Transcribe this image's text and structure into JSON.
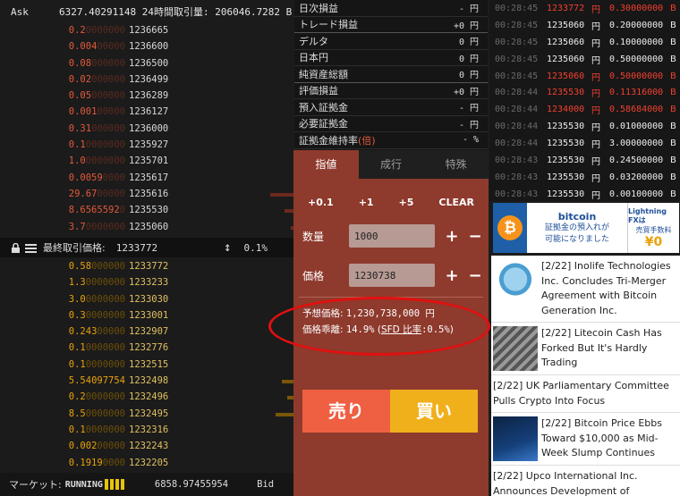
{
  "book": {
    "ask_label": "Ask",
    "header_text": "6327.40291148 24時間取引量: 206046.7282 B",
    "asks": [
      {
        "amt": "0.2",
        "dim": "0000000",
        "px": "1236665",
        "bar": 0
      },
      {
        "amt": "0.004",
        "dim": "00000",
        "px": "1236600",
        "bar": 0
      },
      {
        "amt": "0.08",
        "dim": "000000",
        "px": "1236500",
        "bar": 0
      },
      {
        "amt": "0.02",
        "dim": "000000",
        "px": "1236499",
        "bar": 0
      },
      {
        "amt": "0.05",
        "dim": "000000",
        "px": "1236289",
        "bar": 0
      },
      {
        "amt": "0.001",
        "dim": "00000",
        "px": "1236127",
        "bar": 0
      },
      {
        "amt": "0.31",
        "dim": "000000",
        "px": "1236000",
        "bar": 0
      },
      {
        "amt": "0.1",
        "dim": "0000000",
        "px": "1235927",
        "bar": 0
      },
      {
        "amt": "1.0",
        "dim": "0000000",
        "px": "1235701",
        "bar": 0
      },
      {
        "amt": "0.0059",
        "dim": "0000",
        "px": "1235617",
        "bar": 0
      },
      {
        "amt": "29.67",
        "dim": "00000",
        "px": "1235616",
        "bar": 0.08
      },
      {
        "amt": "8.6565592",
        "dim": "0",
        "px": "1235530",
        "bar": 0.03
      },
      {
        "amt": "3.7",
        "dim": "0000000",
        "px": "1235060",
        "bar": 0.01
      }
    ],
    "last_price_label": "最終取引価格:",
    "last_price": "1233772",
    "spread_pct": "0.1%",
    "bids": [
      {
        "px": "1233772",
        "amt": "0.58",
        "dim": "000000",
        "bar": 0
      },
      {
        "px": "1233233",
        "amt": "1.3",
        "dim": "0000000",
        "bar": 0
      },
      {
        "px": "1233030",
        "amt": "3.0",
        "dim": "0000000",
        "bar": 0
      },
      {
        "px": "1233001",
        "amt": "0.3",
        "dim": "0000000",
        "bar": 0
      },
      {
        "px": "1232907",
        "amt": "0.243",
        "dim": "00000",
        "bar": 0
      },
      {
        "px": "1232776",
        "amt": "0.1",
        "dim": "0000000",
        "bar": 0
      },
      {
        "px": "1232515",
        "amt": "0.1",
        "dim": "0000000",
        "bar": 0
      },
      {
        "px": "1232498",
        "amt": "5.54097754",
        "dim": "",
        "bar": 0.04
      },
      {
        "px": "1232496",
        "amt": "0.2",
        "dim": "0000000",
        "bar": 0.02
      },
      {
        "px": "1232495",
        "amt": "8.5",
        "dim": "0000000",
        "bar": 0.06
      },
      {
        "px": "1232316",
        "amt": "0.1",
        "dim": "0000000",
        "bar": 0
      },
      {
        "px": "1232243",
        "amt": "0.002",
        "dim": "00000",
        "bar": 0
      },
      {
        "px": "1232205",
        "amt": "0.1919",
        "dim": "0000",
        "bar": 0
      }
    ],
    "market_label": "マーケット:",
    "market_status": "RUNNING",
    "bid_volume": "6858.97455954",
    "bid_label": "Bid",
    "colors": {
      "ask": "#e25a3a",
      "bid": "#e8a20c"
    }
  },
  "account": {
    "rows": [
      {
        "label": "日次損益",
        "value": "- 円"
      },
      {
        "label": "トレード損益",
        "value": "+0 円"
      },
      {
        "label": "デルタ",
        "value": "0 円"
      },
      {
        "label": "日本円",
        "value": "0 円"
      },
      {
        "label": "純資産総額",
        "value": "0 円"
      },
      {
        "label": "評価損益",
        "value": "+0 円"
      },
      {
        "label": "預入証拠金",
        "value": "- 円"
      },
      {
        "label": "必要証拠金",
        "value": "- 円"
      },
      {
        "label": "証拠金維持率",
        "label_suffix": "(倍)",
        "value": "- %"
      }
    ]
  },
  "order": {
    "tabs": [
      "指値",
      "成行",
      "特殊"
    ],
    "quick_buttons": [
      "+0.1",
      "+1",
      "+5",
      "CLEAR"
    ],
    "qty_label": "数量",
    "qty_value": "1000",
    "price_label": "価格",
    "price_value": "1230738",
    "plus": "+",
    "minus": "−",
    "est_label": "予想価格:",
    "est_value": "1,230,738,000 円",
    "dev_label": "価格乖離:",
    "dev_value": "14.9%",
    "sfd_label": "SFD 比率",
    "sfd_value": ":0.5%",
    "sell_label": "売り",
    "buy_label": "買い",
    "colors": {
      "panel": "#8e3a2d",
      "sell": "#ef5f42",
      "buy": "#f0b01c"
    }
  },
  "trades": [
    {
      "time": "00:28:45",
      "price": "1233772",
      "yen": "円",
      "amt": "0.30000000",
      "unit": "B",
      "side": "sell"
    },
    {
      "time": "00:28:45",
      "price": "1235060",
      "yen": "円",
      "amt": "0.20000000",
      "unit": "B",
      "side": "buy"
    },
    {
      "time": "00:28:45",
      "price": "1235060",
      "yen": "円",
      "amt": "0.10000000",
      "unit": "B",
      "side": "buy"
    },
    {
      "time": "00:28:45",
      "price": "1235060",
      "yen": "円",
      "amt": "0.50000000",
      "unit": "B",
      "side": "buy"
    },
    {
      "time": "00:28:45",
      "price": "1235060",
      "yen": "円",
      "amt": "0.50000000",
      "unit": "B",
      "side": "sell"
    },
    {
      "time": "00:28:44",
      "price": "1235530",
      "yen": "円",
      "amt": "0.11316000",
      "unit": "B",
      "side": "sell"
    },
    {
      "time": "00:28:44",
      "price": "1234000",
      "yen": "円",
      "amt": "0.58684000",
      "unit": "B",
      "side": "sell"
    },
    {
      "time": "00:28:44",
      "price": "1235530",
      "yen": "円",
      "amt": "0.01000000",
      "unit": "B",
      "side": "buy"
    },
    {
      "time": "00:28:44",
      "price": "1235530",
      "yen": "円",
      "amt": "3.00000000",
      "unit": "B",
      "side": "buy"
    },
    {
      "time": "00:28:43",
      "price": "1235530",
      "yen": "円",
      "amt": "0.24500000",
      "unit": "B",
      "side": "buy"
    },
    {
      "time": "00:28:43",
      "price": "1235530",
      "yen": "円",
      "amt": "0.03200000",
      "unit": "B",
      "side": "buy"
    },
    {
      "time": "00:28:43",
      "price": "1235530",
      "yen": "円",
      "amt": "0.00100000",
      "unit": "B",
      "side": "buy"
    }
  ],
  "ad": {
    "brand": "bitcoin",
    "line1": "証拠金の預入れが",
    "line2": "可能になりました",
    "product": "Lightning FXは",
    "fee": "売買手数料",
    "zero": "¥0"
  },
  "news": [
    {
      "text": "[2/22] Inolife Technologies Inc. Concludes Tri-Merger Agreement with Bitcoin Generation Inc.",
      "thumb": "inolife"
    },
    {
      "text": "[2/22] Litecoin Cash Has Forked But It's Hardly Trading",
      "thumb": "litecoin"
    },
    {
      "text": "[2/22] UK Parliamentary Committee Pulls Crypto Into Focus",
      "thumb": ""
    },
    {
      "text": "[2/22] Bitcoin Price Ebbs Toward $10,000 as Mid-Week Slump Continues",
      "thumb": "chart"
    },
    {
      "text": "[2/22] Upco International Inc. Announces Development of Advanced Blockchain",
      "thumb": ""
    }
  ]
}
